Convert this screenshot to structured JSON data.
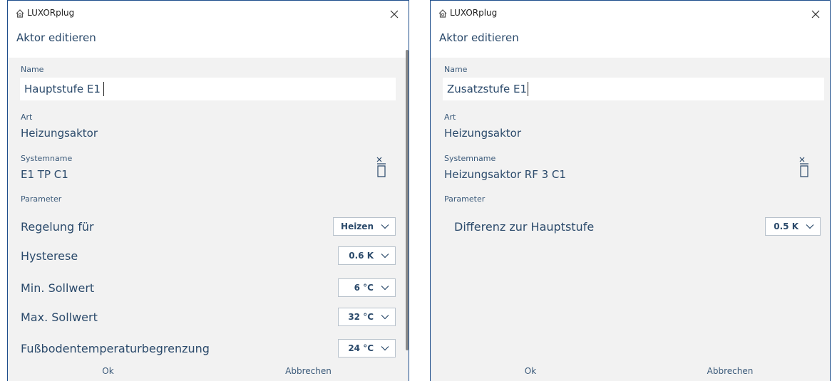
{
  "dialogs": [
    {
      "app_title": "LUXORplug",
      "page_title": "Aktor editieren",
      "name_label": "Name",
      "name_value": "Hauptstufe E1",
      "art_label": "Art",
      "art_value": "Heizungsaktor",
      "systemname_label": "Systemname",
      "systemname_value": "E1 TP C1",
      "parameter_label": "Parameter",
      "params": [
        {
          "label": "Regelung für",
          "value": "Heizen"
        },
        {
          "label": "Hysterese",
          "value": "0.6 K"
        },
        {
          "label": "Min. Sollwert",
          "value": "6 °C"
        },
        {
          "label": "Max. Sollwert",
          "value": "32 °C"
        },
        {
          "label": "Fußbodentemperaturbegrenzung",
          "value": "24 °C"
        }
      ],
      "ok_label": "Ok",
      "cancel_label": "Abbrechen"
    },
    {
      "app_title": "LUXORplug",
      "page_title": "Aktor editieren",
      "name_label": "Name",
      "name_value": "Zusatzstufe E1",
      "art_label": "Art",
      "art_value": "Heizungsaktor",
      "systemname_label": "Systemname",
      "systemname_value": "Heizungsaktor RF 3 C1",
      "parameter_label": "Parameter",
      "params": [
        {
          "label": "Differenz zur Hauptstufe",
          "value": "0.5 K"
        }
      ],
      "ok_label": "Ok",
      "cancel_label": "Abbrechen"
    }
  ],
  "icons": {
    "app": "house-icon",
    "close": "close-icon",
    "clear": "clear-icon",
    "dropdown": "chevron-down-icon"
  },
  "colors": {
    "window_border": "#1f4e8c",
    "text": "#2b4a6b",
    "background": "#f2f2f2"
  }
}
